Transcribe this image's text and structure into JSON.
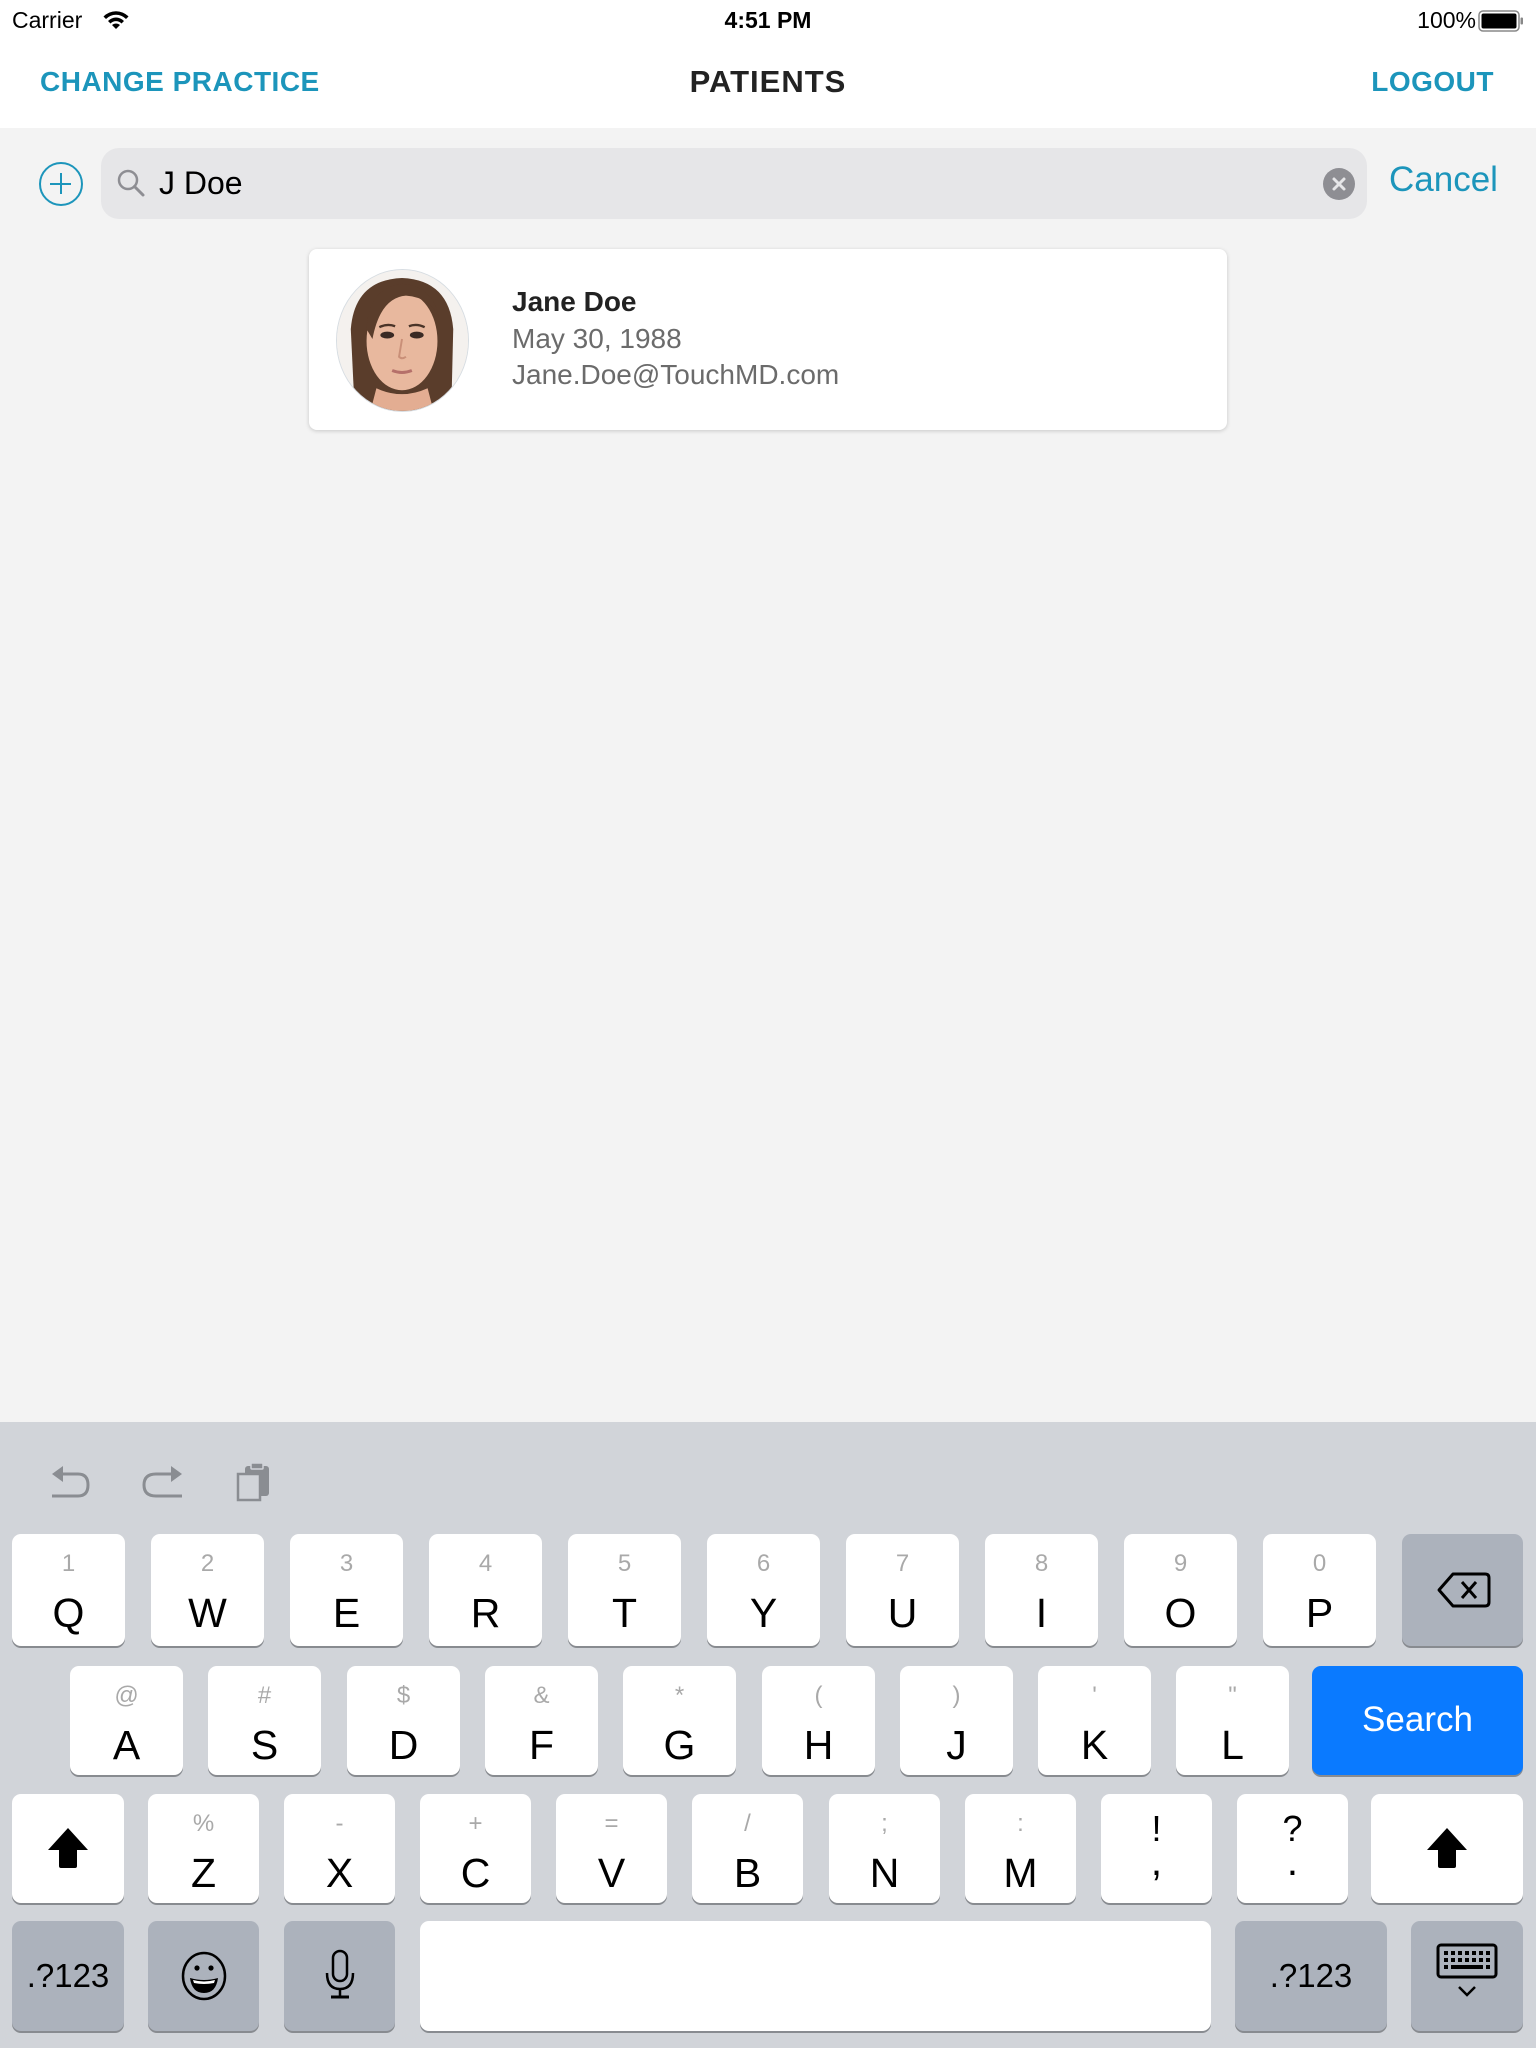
{
  "status_bar": {
    "carrier": "Carrier",
    "time": "4:51 PM",
    "battery_percent": "100%",
    "battery_level": 1.0,
    "wifi_icon": "wifi-icon",
    "battery_icon": "battery-icon"
  },
  "nav": {
    "left_action": "CHANGE PRACTICE",
    "title": "PATIENTS",
    "right_action": "LOGOUT"
  },
  "colors": {
    "accent": "#1c95bb",
    "keyboard_bg": "#d1d4d9",
    "search_key": "#0a7aff",
    "content_bg": "#f3f3f3"
  },
  "search": {
    "add_icon": "plus-circle-icon",
    "search_icon": "search-icon",
    "value": "J Doe",
    "clear_icon": "clear-icon",
    "cancel_label": "Cancel"
  },
  "results": [
    {
      "name": "Jane Doe",
      "dob": "May 30, 1988",
      "email": "Jane.Doe@TouchMD.com",
      "avatar": "patient-photo"
    }
  ],
  "keyboard": {
    "toolbar": [
      "undo-icon",
      "redo-icon",
      "paste-icon"
    ],
    "row1": [
      {
        "alt": "1",
        "key": "Q"
      },
      {
        "alt": "2",
        "key": "W"
      },
      {
        "alt": "3",
        "key": "E"
      },
      {
        "alt": "4",
        "key": "R"
      },
      {
        "alt": "5",
        "key": "T"
      },
      {
        "alt": "6",
        "key": "Y"
      },
      {
        "alt": "7",
        "key": "U"
      },
      {
        "alt": "8",
        "key": "I"
      },
      {
        "alt": "9",
        "key": "O"
      },
      {
        "alt": "0",
        "key": "P"
      }
    ],
    "row2": [
      {
        "alt": "@",
        "key": "A"
      },
      {
        "alt": "#",
        "key": "S"
      },
      {
        "alt": "$",
        "key": "D"
      },
      {
        "alt": "&",
        "key": "F"
      },
      {
        "alt": "*",
        "key": "G"
      },
      {
        "alt": "(",
        "key": "H"
      },
      {
        "alt": ")",
        "key": "J"
      },
      {
        "alt": "'",
        "key": "K"
      },
      {
        "alt": "\"",
        "key": "L"
      }
    ],
    "row3": [
      {
        "alt": "%",
        "key": "Z"
      },
      {
        "alt": "-",
        "key": "X"
      },
      {
        "alt": "+",
        "key": "C"
      },
      {
        "alt": "=",
        "key": "V"
      },
      {
        "alt": "/",
        "key": "B"
      },
      {
        "alt": ";",
        "key": "N"
      },
      {
        "alt": ":",
        "key": "M"
      },
      {
        "alt": "!",
        "key": ","
      },
      {
        "alt": "?",
        "key": "."
      }
    ],
    "search_label": "Search",
    "numbers_label": ".?123",
    "space_label": "",
    "delete_icon": "delete-icon",
    "shift_icon": "shift-icon",
    "emoji_icon": "emoji-icon",
    "mic_icon": "microphone-icon",
    "dismiss_icon": "keyboard-dismiss-icon"
  }
}
